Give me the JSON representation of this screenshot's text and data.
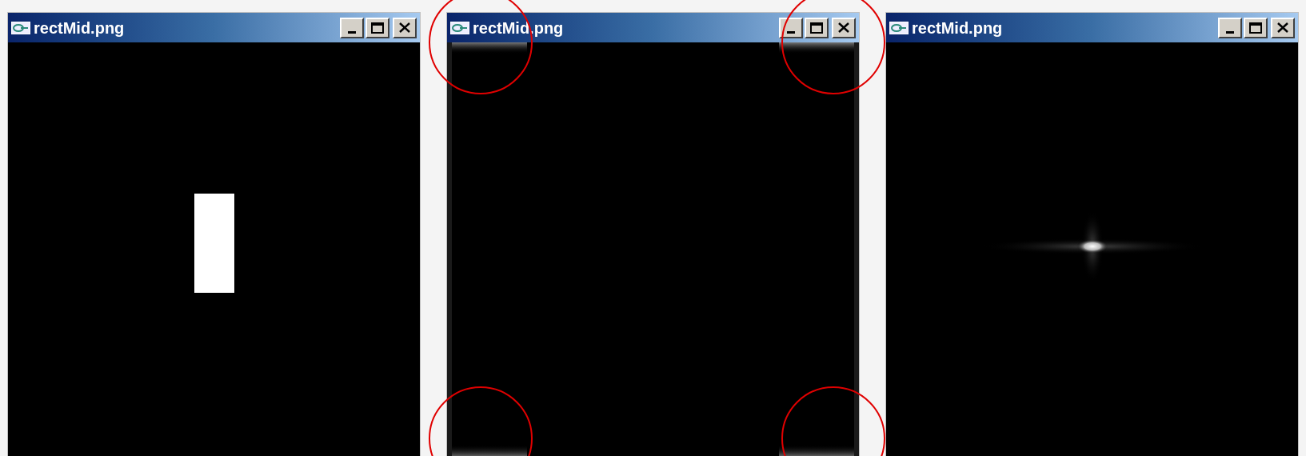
{
  "windows": [
    {
      "title": "rectMid.png",
      "kind": "rectangle",
      "highlight_corners": false
    },
    {
      "title": "rectMid.png",
      "kind": "edges",
      "highlight_corners": true
    },
    {
      "title": "rectMid.png",
      "kind": "spectrum",
      "highlight_corners": false
    }
  ]
}
